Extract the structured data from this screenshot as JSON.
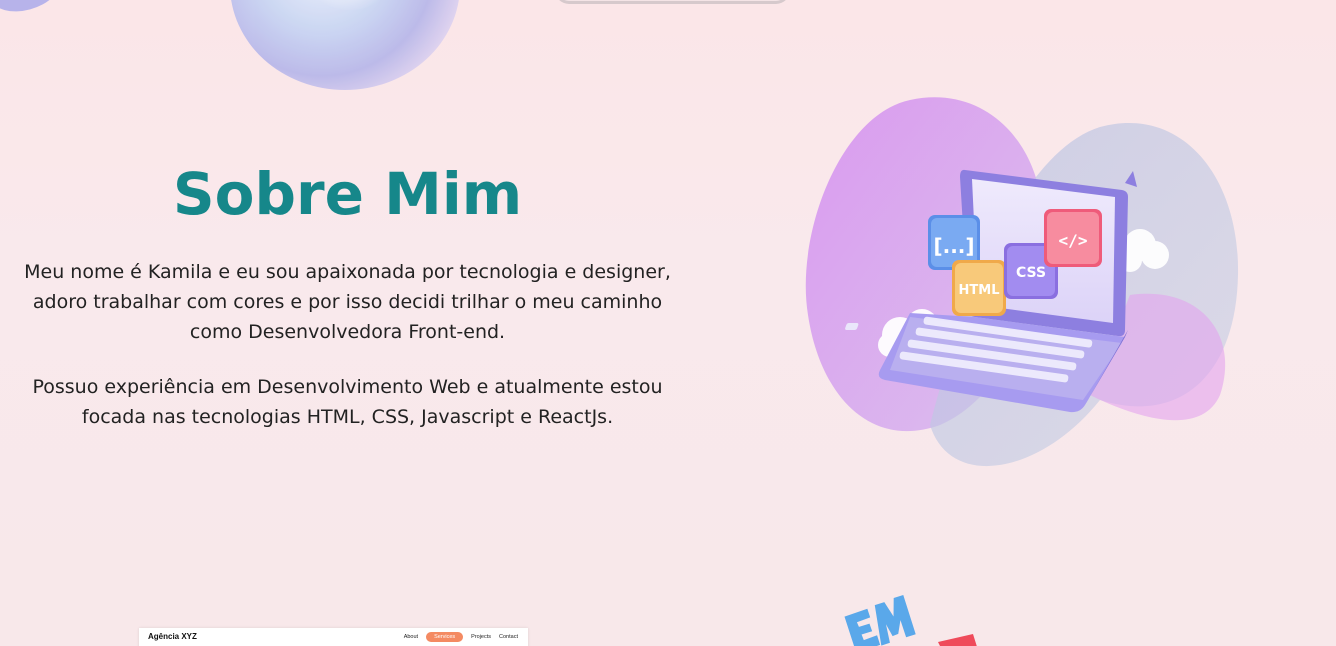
{
  "about": {
    "title": "Sobre Mim",
    "paragraph_1": "Meu nome é Kamila e eu sou apaixonada por tecnologia e designer, adoro trabalhar com cores e por isso decidi trilhar o meu caminho como Desenvolvedora Front-end.",
    "paragraph_2": "Possuo experiência em Desenvolvimento Web e atualmente estou focada nas tecnologias HTML, CSS, Javascript e ReactJs."
  },
  "illustration": {
    "icon": "laptop-code-illustration",
    "badges": {
      "brackets": "[...]",
      "html": "HTML",
      "css": "CSS",
      "code": "</>"
    }
  },
  "project_preview": {
    "brand": "Agência XYZ",
    "nav": [
      "About",
      "Services",
      "Projects",
      "Contact"
    ],
    "active_nav": "Services",
    "accent": "#f48a62"
  },
  "colors": {
    "title": "#16878a",
    "background": "#fbe6e8"
  }
}
